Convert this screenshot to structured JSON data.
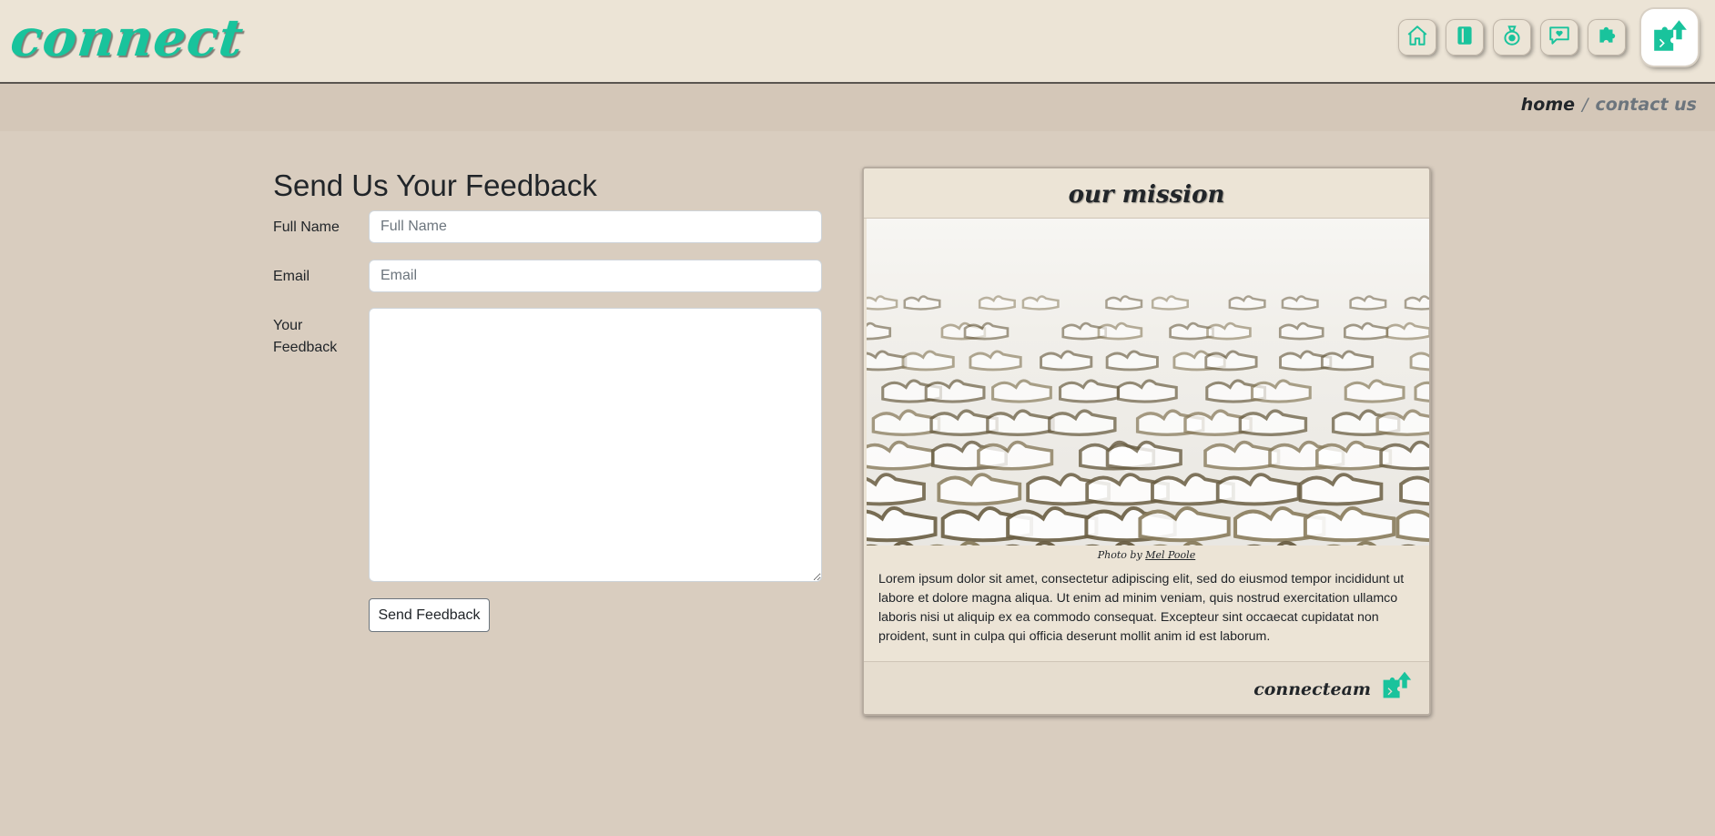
{
  "brand": {
    "name": "connect"
  },
  "colors": {
    "accent": "#19c39c",
    "background": "#d9cdbf",
    "panel": "#ece4d6"
  },
  "nav": {
    "items": [
      {
        "name": "home-icon",
        "icon": "house"
      },
      {
        "name": "book-icon",
        "icon": "notebook"
      },
      {
        "name": "money-bag-icon",
        "icon": "money-bag"
      },
      {
        "name": "chat-heart-icon",
        "icon": "chat-heart"
      },
      {
        "name": "puzzle-icon",
        "icon": "puzzle-piece"
      },
      {
        "name": "connect-logo-icon",
        "icon": "puzzle-arrow-logo",
        "active": true
      }
    ]
  },
  "breadcrumb": {
    "home": "home",
    "separator": "/",
    "current": "contact us"
  },
  "form": {
    "title": "Send Us Your Feedback",
    "full_name_label": "Full Name",
    "full_name_placeholder": "Full Name",
    "full_name_value": "",
    "email_label": "Email",
    "email_placeholder": "Email",
    "email_value": "",
    "feedback_label": "Your Feedback",
    "feedback_value": "",
    "submit_label": "Send Feedback"
  },
  "mission_card": {
    "title": "our mission",
    "image_icon": "scattered-white-puzzle-pieces-photo",
    "photo_credit_prefix": "Photo by",
    "photo_credit_author": "Mel Poole",
    "body": "Lorem ipsum dolor sit amet, consectetur adipiscing elit, sed do eiusmod tempor incididunt ut labore et dolore magna aliqua. Ut enim ad minim veniam, quis nostrud exercitation ullamco laboris nisi ut aliquip ex ea commodo consequat. Excepteur sint occaecat cupidatat non proident, sunt in culpa qui officia deserunt mollit anim id est laborum.",
    "footer_signature": "connecteam"
  }
}
